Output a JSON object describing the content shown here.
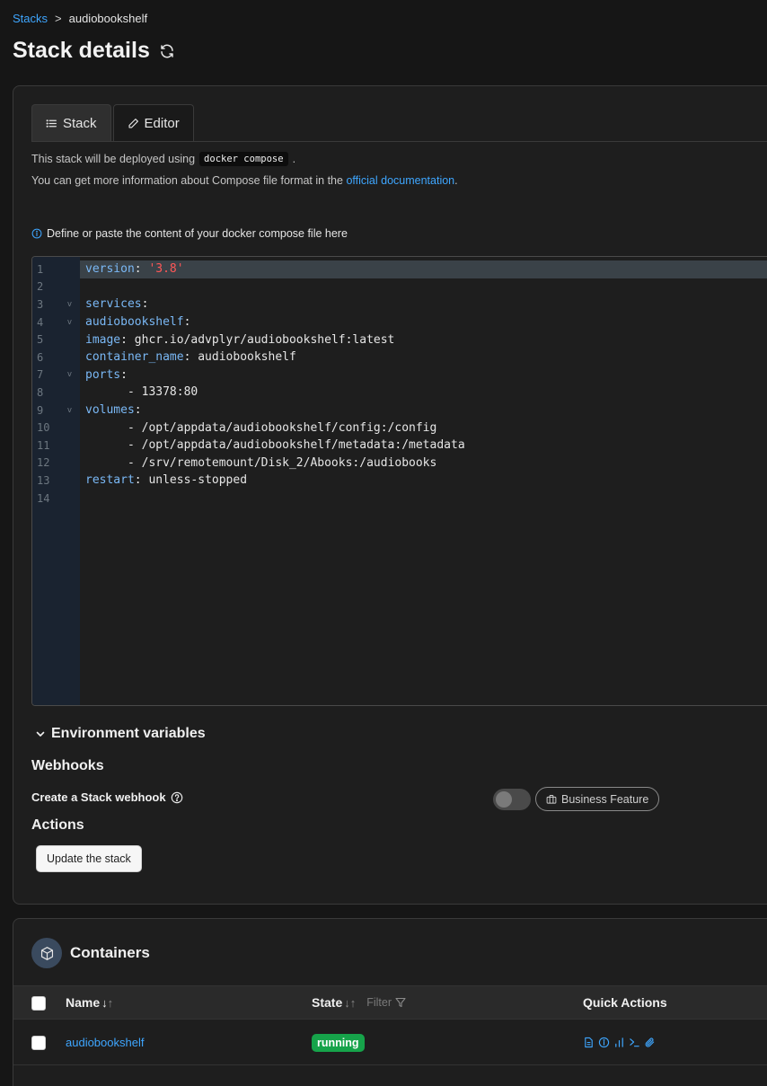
{
  "breadcrumb": {
    "root": "Stacks",
    "separator": ">",
    "current": "audiobookshelf"
  },
  "page": {
    "title": "Stack details"
  },
  "tabs": [
    {
      "label": "Stack",
      "icon": "list-icon",
      "active": true
    },
    {
      "label": "Editor",
      "icon": "pencil-icon",
      "active": false
    }
  ],
  "info": {
    "deploy_prefix": "This stack will be deployed using",
    "deploy_code": "docker compose",
    "deploy_suffix": ".",
    "docs_prefix": "You can get more information about Compose file format in the",
    "docs_link": "official documentation",
    "docs_suffix": "."
  },
  "editor": {
    "hint": "Define or paste the content of your docker compose file here",
    "line_numbers": [
      "1",
      "2",
      "3",
      "4",
      "5",
      "6",
      "7",
      "8",
      "9",
      "10",
      "11",
      "12",
      "13",
      "14"
    ]
  },
  "env": {
    "label": "Environment variables"
  },
  "webhooks": {
    "title": "Webhooks",
    "create_label": "Create a Stack webhook",
    "business_label": "Business Feature",
    "enabled": false
  },
  "actions": {
    "title": "Actions",
    "update_button": "Update the stack"
  },
  "containers": {
    "title": "Containers",
    "columns": {
      "name": "Name",
      "state": "State",
      "filter": "Filter",
      "quick_actions": "Quick Actions"
    },
    "rows": [
      {
        "name": "audiobookshelf",
        "state": "running"
      }
    ]
  },
  "colors": {
    "link": "#3ea6ff",
    "running": "#16a34a",
    "yaml_key": "#7ab8f5",
    "yaml_string": "#ff5757"
  }
}
